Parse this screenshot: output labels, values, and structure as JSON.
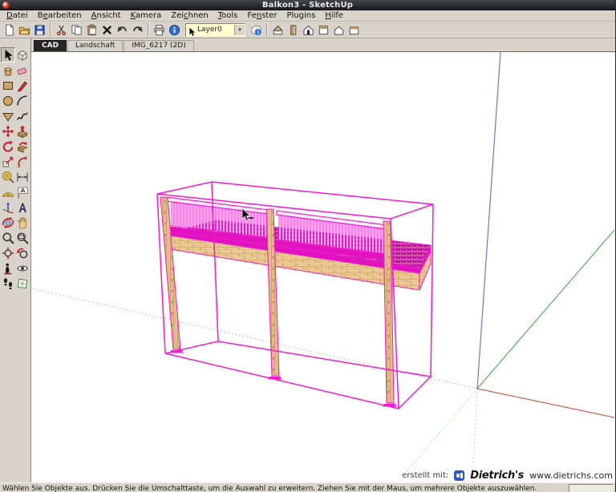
{
  "window": {
    "title": "Balkon3 - SketchUp"
  },
  "menu": {
    "items": [
      {
        "label": "Datei",
        "mnemonic": 0
      },
      {
        "label": "Bearbeiten",
        "mnemonic": 1
      },
      {
        "label": "Ansicht",
        "mnemonic": 0
      },
      {
        "label": "Kamera",
        "mnemonic": 0
      },
      {
        "label": "Zeichnen",
        "mnemonic": 3
      },
      {
        "label": "Tools",
        "mnemonic": 0
      },
      {
        "label": "Fenster",
        "mnemonic": 2
      },
      {
        "label": "Plugins",
        "mnemonic": -1
      },
      {
        "label": "Hilfe",
        "mnemonic": 0
      }
    ]
  },
  "toolbar": {
    "items": [
      "new-file",
      "open-folder",
      "save",
      "sep",
      "cut",
      "copy",
      "paste",
      "delete",
      "undo",
      "redo",
      "sep",
      "print",
      "model-info",
      "combo",
      "entity-info",
      "sep",
      "view-iso",
      "view-right",
      "view-front",
      "view-top",
      "view-back",
      "view-left"
    ],
    "layer_combo": {
      "value": "Layer0",
      "dropdown_glyph": "▾"
    }
  },
  "scene_tabs": [
    {
      "label": "CAD",
      "active": true
    },
    {
      "label": "Landschaft",
      "active": false
    },
    {
      "label": "IMG_6217 (2D)",
      "active": false
    }
  ],
  "tool_palette": [
    "select",
    "make-component",
    "paint-bucket",
    "eraser",
    "rectangle",
    "line",
    "circle",
    "arc",
    "polygon",
    "freehand",
    "move",
    "push-pull",
    "rotate",
    "follow-me",
    "scale",
    "offset",
    "tape-measure",
    "dimension",
    "protractor",
    "text",
    "axes",
    "3d-text",
    "orbit",
    "pan",
    "zoom",
    "zoom-window",
    "zoom-extents",
    "previous",
    "position-camera",
    "look-around",
    "walk",
    "section-plane"
  ],
  "active_tool": "select",
  "canvas": {
    "watermark": {
      "prefix": "erstellt mit:",
      "brand": "Dietrich's",
      "url": "www.dietrichs.com"
    },
    "colors": {
      "selection": "#f318d2",
      "deck_fill": "#cf2aad",
      "deck_hatch": "#9c0d7e",
      "wood_light": "#e9c893",
      "wood_mid": "#d2a76a",
      "wood_grain": "#a8763d",
      "axis_red": "#cf3b2a",
      "axis_green": "#3ca23c",
      "axis_blue": "#7272d2"
    }
  },
  "status_bar": {
    "message": "Wählen Sie Objekte aus. Drücken Sie die Umschalttaste, um die Auswahl zu erweitern. Ziehen Sie mit der Maus, um mehrere Objekte auszuwählen.",
    "measurement_value": ""
  }
}
